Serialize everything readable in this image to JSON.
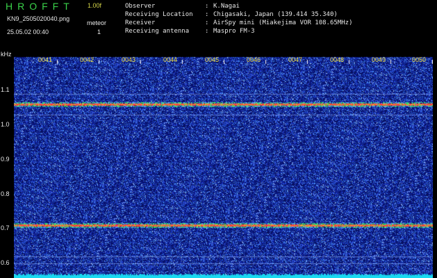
{
  "header": {
    "logo": "HROFFT",
    "version": "1.00f",
    "filename": "KN9_2505020040.png",
    "datetime": "25.05.02 00:40",
    "meteor_label": "meteor",
    "meteor_count": "1"
  },
  "info": [
    {
      "key": "Observer",
      "sep": ":",
      "value": "K.Nagai"
    },
    {
      "key": "Receiving Location",
      "sep": ":",
      "value": "Chigasaki, Japan (139.414 35.340)"
    },
    {
      "key": "Receiver",
      "sep": ":",
      "value": "AirSpy mini (Miakejima VOR 108.65MHz)"
    },
    {
      "key": "Receiving antenna",
      "sep": ":",
      "value": "Maspro FM-3"
    }
  ],
  "spectrogram": {
    "y_unit": "kHz",
    "y_ticks": [
      "1.1",
      "1.0",
      "0.9",
      "0.8",
      "0.7",
      "0.6"
    ],
    "x_ticks": [
      "0041",
      "0042",
      "0043",
      "0044",
      "0045",
      "0046",
      "0047",
      "0048",
      "0049",
      "0050"
    ],
    "signal_lines_khz": [
      1.06,
      0.71
    ],
    "colors": {
      "background": "#000000",
      "noise_low": "#0a1a6e",
      "noise_high": "#4a6cff",
      "signal": "#ff3a3a",
      "signal_edge": "#3ce860",
      "floor": "#18d8f0",
      "tick_label": "#f0e040"
    }
  }
}
